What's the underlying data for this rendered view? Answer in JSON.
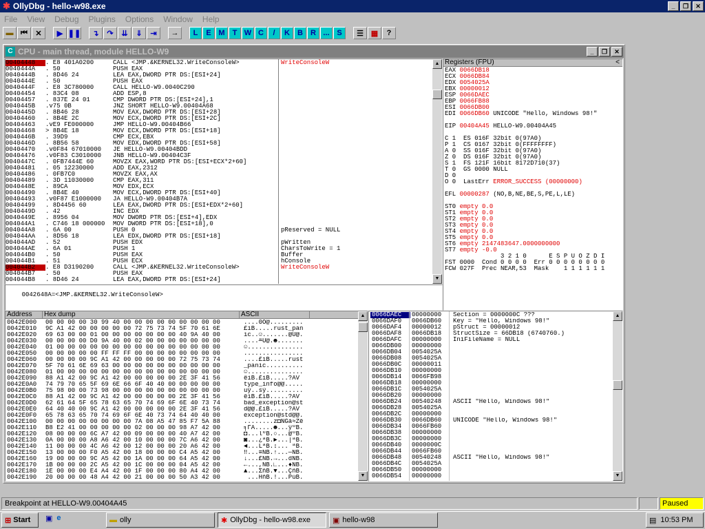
{
  "app": {
    "title": "OllyDbg - hello-w98.exe",
    "menu": [
      "File",
      "View",
      "Debug",
      "Plugins",
      "Options",
      "Window",
      "Help"
    ]
  },
  "toolbar": {
    "letters": [
      "L",
      "E",
      "M",
      "T",
      "W",
      "C",
      "/",
      "K",
      "B",
      "R",
      "...",
      "S"
    ]
  },
  "cpu": {
    "title": "CPU - main thread, module HELLO-W9"
  },
  "disasm": {
    "rows": [
      [
        "00404448",
        ". E8 401A0200",
        "CALL <JMP.&KERNEL32.WriteConsoleW>",
        "WriteConsoleW"
      ],
      [
        "0040444A",
        ". 50",
        "PUSH EAX",
        ""
      ],
      [
        "0040444B",
        ". 8D46 24",
        "LEA EAX,DWORD PTR DS:[ESI+24]",
        ""
      ],
      [
        "0040444E",
        ". 50",
        "PUSH EAX",
        ""
      ],
      [
        "0040444F",
        ". E8 3C780000",
        "CALL HELLO-W9.0040C290",
        ""
      ],
      [
        "00404454",
        ". 83C4 08",
        "ADD ESP,8",
        ""
      ],
      [
        "00404457",
        ". 837E 24 01",
        "CMP DWORD PTR DS:[ESI+24],1",
        ""
      ],
      [
        "0040445B",
        ".v75 0B",
        "JNZ SHORT HELLO-W9.00404A68",
        ""
      ],
      [
        "0040445D",
        ". 8B46 28",
        "MOV EAX,DWORD PTR DS:[ESI+28]",
        ""
      ],
      [
        "00404460",
        ". 8B4E 2C",
        "MOV ECX,DWORD PTR DS:[ESI+2C]",
        ""
      ],
      [
        "00404463",
        ".vE9 FE000000",
        "JMP HELLO-W9.00404B66",
        ""
      ],
      [
        "00404468",
        "> 8B4E 18",
        "MOV ECX,DWORD PTR DS:[ESI+18]",
        ""
      ],
      [
        "0040446B",
        ". 39D9",
        "CMP ECX,EBX",
        ""
      ],
      [
        "0040446D",
        ". 8B56 58",
        "MOV EDX,DWORD PTR DS:[ESI+58]",
        ""
      ],
      [
        "00404470",
        ".v0F84 67010000",
        "JE HELLO-W9.00404BDD",
        ""
      ],
      [
        "00404476",
        ".v0F83 C3010000",
        "JNB HELLO-W9.00404C3F",
        ""
      ],
      [
        "0040447C",
        ". 0FB7444E 60",
        "MOVZX EAX,WORD PTR DS:[ESI+ECX*2+60]",
        ""
      ],
      [
        "00404481",
        ". 05 12230000",
        "ADD EAX,2312",
        ""
      ],
      [
        "00404486",
        ". 0FB7C0",
        "MOVZX EAX,AX",
        ""
      ],
      [
        "00404489",
        ". 3D 11030000",
        "CMP EAX,311",
        ""
      ],
      [
        "0040448E",
        ". 89CA",
        "MOV EDX,ECX",
        ""
      ],
      [
        "00404490",
        ". 8B4E 40",
        "MOV ECX,DWORD PTR DS:[ESI+40]",
        ""
      ],
      [
        "00404493",
        ".v0F87 E1000000",
        "JA HELLO-W9.00404B7A",
        ""
      ],
      [
        "00404499",
        ". 8D4456 60",
        "LEA EAX,DWORD PTR DS:[ESI+EDX*2+60]",
        ""
      ],
      [
        "0040449D",
        ". 42",
        "INC EDX",
        ""
      ],
      [
        "0040449E",
        ". 8956 04",
        "MOV DWORD PTR DS:[ESI+4],EDX",
        ""
      ],
      [
        "004044A1",
        ". C746 18 000000",
        "MOV DWORD PTR DS:[ESI+18],0",
        ""
      ],
      [
        "004044A8",
        ". 6A 00",
        "PUSH 0",
        "pReserved = NULL"
      ],
      [
        "004044AA",
        ". 8D56 18",
        "LEA EDX,DWORD PTR DS:[ESI+18]",
        ""
      ],
      [
        "004044AD",
        ". 52",
        "PUSH EDX",
        "pWritten"
      ],
      [
        "004044AE",
        ". 6A 01",
        "PUSH 1",
        "CharsToWrite = 1"
      ],
      [
        "004044B0",
        ". 50",
        "PUSH EAX",
        "Buffer"
      ],
      [
        "004044B1",
        ". 51",
        "PUSH ECX",
        "hConsole"
      ],
      [
        "004044B2",
        ". E8 D3190200",
        "CALL <JMP.&KERNEL32.WriteConsoleW>",
        "WriteConsoleW"
      ],
      [
        "004044B7",
        ". 50",
        "PUSH EAX",
        ""
      ],
      [
        "004044B8",
        ". 8D46 24",
        "LEA EAX,DWORD PTR DS:[ESI+24]",
        ""
      ]
    ],
    "info": "0042648A=<JMP.&KERNEL32.WriteConsoleW>"
  },
  "regs": {
    "title": "Registers (FPU)",
    "lines": [
      "EAX 0066DB18",
      "ECX 0066DB84",
      "EDX 0054025A",
      "EBX 00000012",
      "ESP 0066DAEC",
      "EBP 0066FB88",
      "ESI 0066DB00",
      "EDI 0066DB60 UNICODE \"Hello, Windows 98!\"",
      "",
      "EIP 00404A45 HELLO-W9.00404A45",
      "",
      "C 1  ES 016F 32bit 0(97A0)",
      "P 1  CS 0167 32bit 0(FFFFFFFF)",
      "A 0  SS 016F 32bit 0(97A0)",
      "Z 0  DS 016F 32bit 0(97A0)",
      "S 1  FS 121F 16bit 8172D710(37)",
      "T 0  GS 0000 NULL",
      "D 0",
      "O 0  LastErr ERROR_SUCCESS (00000000)",
      "",
      "EFL 00000287 (NO,B,NE,BE,S,PE,L,LE)",
      "",
      "ST0 empty 0.0",
      "ST1 empty 0.0",
      "ST2 empty 0.0",
      "ST3 empty 0.0",
      "ST4 empty 0.0",
      "ST5 empty 0.0",
      "ST6 empty 2147483647.0000000000",
      "ST7 empty -0.0",
      "               3 2 1 0      E S P U O Z D I",
      "FST 0000  Cond 0 0 0 0  Err 0 0 0 0 0 0 0 0",
      "FCW 027F  Prec NEAR,53  Mask    1 1 1 1 1 1"
    ]
  },
  "dump": {
    "headers": [
      "Address",
      "Hex dump",
      "ASCII"
    ],
    "rows": [
      [
        "0042E000",
        "00 00 00 00 30 99 40 00 00 00 00 00 00 00 00 00",
        "....0Ö@........."
      ],
      [
        "0042E010",
        "9C A1 42 00 00 00 00 00 72 75 73 74 5F 70 61 6E",
        "£íB.....rust_pan"
      ],
      [
        "0042E020",
        "69 63 00 00 01 00 00 00 00 00 00 00 40 9A 40 00",
        "ic..☺.......@Ü@."
      ],
      [
        "0042E030",
        "00 00 00 00 D0 9A 40 00 02 00 00 00 00 00 00 00",
        "....╨Ü@.☻......."
      ],
      [
        "0042E040",
        "01 00 00 00 00 00 00 00 00 00 00 00 00 00 00 00",
        "☺..............."
      ],
      [
        "0042E050",
        "00 00 00 00 00 FF FF FF 00 00 00 00 00 00 00 00",
        "................"
      ],
      [
        "0042E060",
        "00 00 00 00 9C A1 42 00 00 00 00 00 72 75 73 74",
        "....£íB.....rust"
      ],
      [
        "0042E070",
        "5F 70 61 6E 69 63 00 00 00 00 00 00 00 00 00 00",
        "_panic.........."
      ],
      [
        "0042E080",
        "01 00 00 00 00 00 00 00 00 00 00 00 00 00 00 00",
        "☺..............."
      ],
      [
        "0042E090",
        "88 A1 42 00 9C A1 42 00 00 00 00 00 2E 3F 41 56",
        "êíB.£íB.....?AV"
      ],
      [
        "0042E0A0",
        "74 79 70 65 5F 69 6E 66 6F 40 40 00 00 00 00 00",
        "type_info@@....."
      ],
      [
        "0042E0B0",
        "75 98 00 00 73 98 00 00 00 00 00 00 00 00 00 00",
        "uÿ..sÿ.........."
      ],
      [
        "0042E0C0",
        "88 A1 42 00 9C A1 42 00 00 00 00 00 2E 3F 41 56",
        "êíB.£íB.....?AV"
      ],
      [
        "0042E0D0",
        "62 61 64 5F 65 78 63 65 70 74 69 6F 6E 40 73 74",
        "bad_exception@st"
      ],
      [
        "0042E0E0",
        "64 40 40 00 9C A1 42 00 00 00 00 00 2E 3F 41 56",
        "d@@.£íB.....?AV"
      ],
      [
        "0042E0F0",
        "65 78 63 65 70 74 69 6F 6E 40 73 74 64 40 40 00",
        "exception@std@@."
      ],
      [
        "0042E100",
        "00 00 00 00 00 00 00 00 7A 08 A5 47 85 F7 5A 88",
        "........z◘ÑGà≈Zê"
      ],
      [
        "0042E110",
        "B8 E2 41 00 00 00 00 00 02 00 00 00 98 A7 42 00",
        "╕ΓA.....☻...ÿºB."
      ],
      [
        "0042E120",
        "08 00 00 00 6C A7 42 00 09 00 00 00 40 A7 42 00",
        "◘...lºB.○...@ºB."
      ],
      [
        "0042E130",
        "0A 00 00 00 A8 A6 42 00 10 00 00 00 7C A6 42 00",
        "◙...¿ªB.►...|ªB."
      ],
      [
        "0042E140",
        "11 00 00 00 4C A6 42 00 12 00 00 00 20 A6 42 00",
        "◄...LªB.↕... ªB."
      ],
      [
        "0042E150",
        "13 00 00 00 F0 A5 42 00 18 00 00 00 C4 A5 42 00",
        "‼...≡ÑB.↑...─ÑB."
      ],
      [
        "0042E160",
        "19 00 00 00 9C A5 42 00 1A 00 00 00 64 A5 42 00",
        "↓...£ÑB.→...dÑB."
      ],
      [
        "0042E170",
        "1B 00 00 00 2C A5 42 00 1C 00 00 00 04 A5 42 00",
        "←...,ÑB.∟...♦ÑB."
      ],
      [
        "0042E180",
        "1E 00 00 00 E4 A4 42 00 1F 00 00 00 80 A4 42 00",
        "▲...ΣñB.▼...ÇñB."
      ],
      [
        "0042E190",
        "20 00 00 00 48 A4 42 00 21 00 00 00 50 A3 42 00",
        " ...HñB.!...PúB."
      ]
    ]
  },
  "stack": {
    "rows": [
      [
        "0066DAEC",
        "00000000",
        "Section = 0000000C ???"
      ],
      [
        "0066DAF0",
        "0066DB60",
        "Key = \"Hello, Windows 98!\""
      ],
      [
        "0066DAF4",
        "00000012",
        "pStruct = 00000012"
      ],
      [
        "0066DAF8",
        "0066DB18",
        "StructSize = 66DB18 (6740760.)"
      ],
      [
        "0066DAFC",
        "00000000",
        "IniFileName = NULL"
      ],
      [
        "0066DB00",
        "00000000",
        ""
      ],
      [
        "0066DB04",
        "0054025A",
        ""
      ],
      [
        "0066DB08",
        "0054025A",
        ""
      ],
      [
        "0066DB0C",
        "00000011",
        ""
      ],
      [
        "0066DB10",
        "00000000",
        ""
      ],
      [
        "0066DB14",
        "0066FB98",
        ""
      ],
      [
        "0066DB18",
        "00000000",
        ""
      ],
      [
        "0066DB1C",
        "0054025A",
        ""
      ],
      [
        "0066DB20",
        "00000000",
        ""
      ],
      [
        "0066DB24",
        "00540248",
        "ASCII \"Hello, Windows 98!\""
      ],
      [
        "0066DB28",
        "0054025A",
        ""
      ],
      [
        "0066DB2C",
        "00000000",
        ""
      ],
      [
        "0066DB30",
        "0066DB60",
        "UNICODE \"Hello, Windows 98!\""
      ],
      [
        "0066DB34",
        "0066FB60",
        ""
      ],
      [
        "0066DB38",
        "00000000",
        ""
      ],
      [
        "0066DB3C",
        "00000000",
        ""
      ],
      [
        "0066DB40",
        "0000000C",
        ""
      ],
      [
        "0066DB44",
        "0066FB60",
        ""
      ],
      [
        "0066DB48",
        "00540248",
        "ASCII \"Hello, Windows 98!\""
      ],
      [
        "0066DB4C",
        "0054025A",
        ""
      ],
      [
        "0066DB50",
        "00000000",
        ""
      ],
      [
        "0066DB54",
        "00000000",
        ""
      ]
    ]
  },
  "status": {
    "text": "Breakpoint at HELLO-W9.00404A45",
    "state": "Paused"
  },
  "taskbar": {
    "start": "Start",
    "items": [
      "olly",
      "OllyDbg - hello-w98.exe",
      "hello-w98"
    ],
    "clock": "10:53 PM"
  }
}
